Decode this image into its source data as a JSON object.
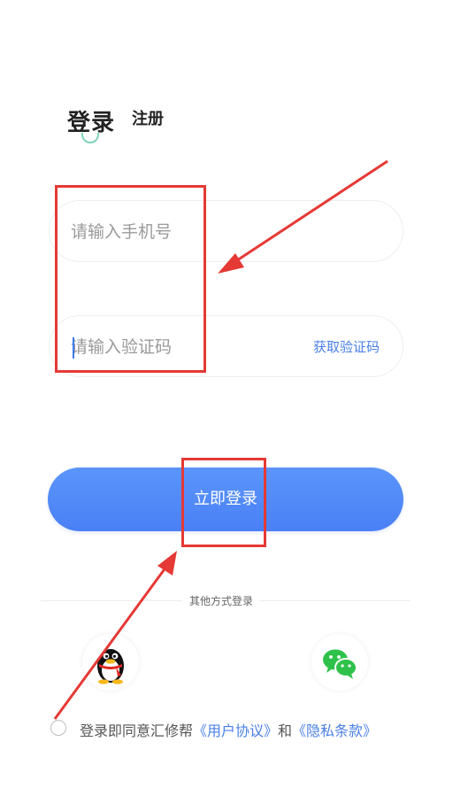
{
  "tabs": {
    "login": "登录",
    "register": "注册"
  },
  "form": {
    "phone_placeholder": "请输入手机号",
    "code_placeholder": "请输入验证码",
    "get_code_label": "获取验证码",
    "submit_label": "立即登录"
  },
  "divider": {
    "label": "其他方式登录"
  },
  "social": [
    {
      "icon": "qq-penguin-icon"
    },
    {
      "icon": "wechat-icon"
    }
  ],
  "agreement": {
    "prefix": "登录即同意汇修帮",
    "user_agreement": "《用户协议》",
    "and": "和",
    "privacy_policy": "《隐私条款》"
  },
  "colors": {
    "accent_blue": "#4a80f5",
    "link_blue": "#4a7fe6",
    "annotation_red": "#e53935",
    "tab_indicator": "#7fd3b5",
    "wechat_green": "#2fc24b"
  }
}
